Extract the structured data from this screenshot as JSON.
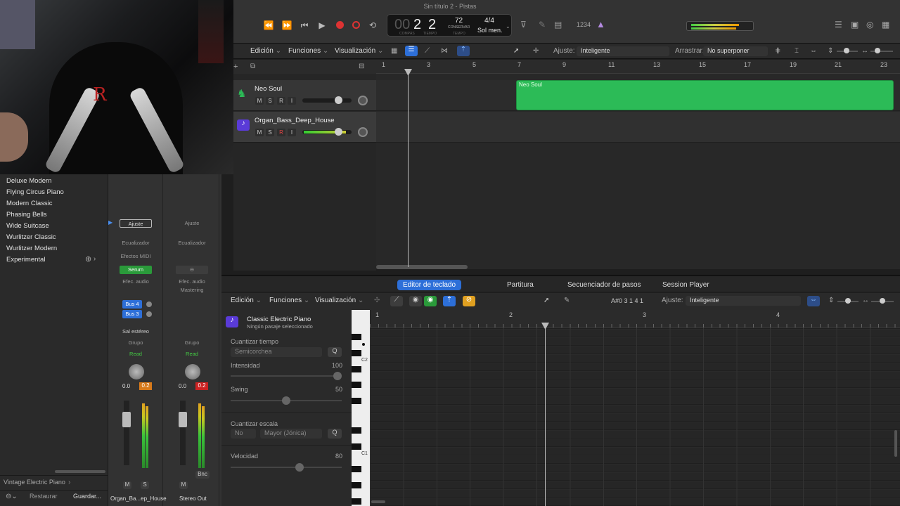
{
  "window": {
    "title": "Sin título 2 - Pistas"
  },
  "lcd": {
    "bar": "2",
    "beat": "2",
    "bar_label": "COMPÁS",
    "beat_label": "TIEMPO",
    "tempo": "72",
    "tempo_label": "CONSERVAR",
    "tempo_sub": "TEMPO",
    "signature": "4/4",
    "key": "Sol men."
  },
  "toolbar": {
    "count_in": "1234"
  },
  "tracks_menu": {
    "edit": "Edición",
    "functions": "Funciones",
    "view": "Visualización",
    "snap_label": "Ajuste:",
    "snap_value": "Inteligente",
    "drag_label": "Arrastrar:",
    "drag_value": "No superponer"
  },
  "ruler": [
    "1",
    "3",
    "5",
    "7",
    "9",
    "11",
    "13",
    "15",
    "17",
    "19",
    "21",
    "23"
  ],
  "tracks": [
    {
      "name": "Neo Soul"
    },
    {
      "name": "Organ_Bass_Deep_House"
    }
  ],
  "track_buttons": {
    "m": "M",
    "s": "S",
    "r": "R",
    "i": "I"
  },
  "region": {
    "name": "Neo Soul"
  },
  "library": {
    "items": [
      "Deluxe Modern",
      "Flying Circus Piano",
      "Modern Classic",
      "Phasing Bells",
      "Wide Suitcase",
      "Wurlitzer Classic",
      "Wurlitzer Modern",
      "Experimental"
    ],
    "patch": "Vintage Electric Piano",
    "restore": "Restaurar",
    "save": "Guardar..."
  },
  "mixer": {
    "strip1": {
      "setting": "Ajuste",
      "eq": "Ecualizador",
      "midi_fx": "Efectos MIDI",
      "instrument": "Serum",
      "audio_fx": "Efec. audio",
      "send1": "Bus 4",
      "send2": "Bus 3",
      "output": "Sal estéreo",
      "group": "Grupo",
      "automation": "Read",
      "vol": "0.0",
      "peak": "0.2",
      "m": "M",
      "s": "S",
      "name": "Organ_Ba...ep_House"
    },
    "strip2": {
      "setting": "Ajuste",
      "eq": "Ecualizador",
      "audio_fx": "Efec. audio",
      "mastering": "Mastering",
      "group": "Grupo",
      "automation": "Read",
      "vol": "0.0",
      "peak": "0.2",
      "m": "M",
      "bnc": "Bnc",
      "name": "Stereo Out"
    }
  },
  "editor": {
    "tabs": [
      "Editor de teclado",
      "Partitura",
      "Secuenciador de pasos",
      "Session Player"
    ],
    "edit": "Edición",
    "functions": "Funciones",
    "view": "Visualización",
    "position": "A#0  3 1 4 1",
    "snap_label": "Ajuste:",
    "snap_value": "Inteligente",
    "region_title": "Classic Electric Piano",
    "region_sub": "Ningún pasaje seleccionado",
    "ruler": [
      "1",
      "2",
      "3",
      "4"
    ],
    "octave_c2": "C2",
    "octave_c1": "C1"
  },
  "inspector": {
    "quantize_time": "Cuantizar tiempo",
    "quantize_value": "Semicorchea",
    "q": "Q",
    "intensity": "Intensidad",
    "intensity_value": "100",
    "swing": "Swing",
    "swing_value": "50",
    "scale_quantize": "Cuantizar escala",
    "scale_no": "No",
    "scale_mode": "Mayor (Jónica)",
    "velocity": "Velocidad",
    "velocity_value": "80"
  }
}
